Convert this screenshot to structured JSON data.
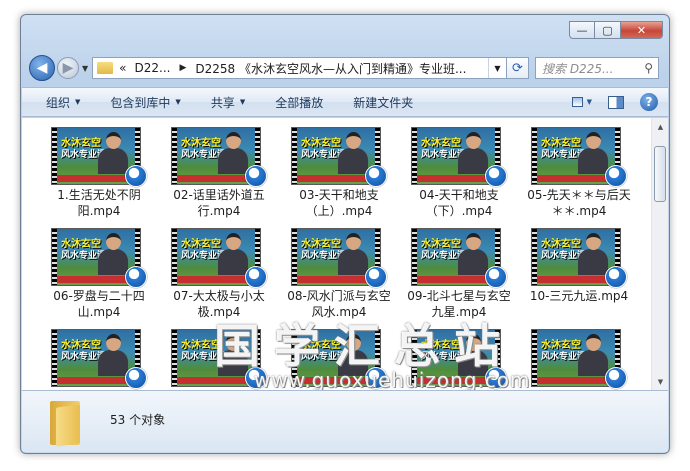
{
  "window": {
    "caption_buttons": [
      "—",
      "▢",
      "✕"
    ]
  },
  "nav": {
    "back_glyph": "◀",
    "forward_glyph": "▶",
    "address_prefix": "«",
    "crumb_1": "D22...",
    "crumb_2": "D2258 《水沐玄空风水—从入门到精通》专业班...",
    "search_placeholder": "搜索 D225..."
  },
  "toolbar": {
    "organize": "组织",
    "include_in_library": "包含到库中",
    "share": "共享",
    "play_all": "全部播放",
    "new_folder": "新建文件夹"
  },
  "thumb_text": {
    "line1": "水沐玄空",
    "line2": "风水专业课"
  },
  "files": [
    {
      "name": "1.生活无处不阴阳.mp4"
    },
    {
      "name": "02-话里话外道五行.mp4"
    },
    {
      "name": "03-天干和地支（上）.mp4"
    },
    {
      "name": "04-天干和地支（下）.mp4"
    },
    {
      "name": "05-先天＊＊与后天＊＊.mp4"
    },
    {
      "name": "06-罗盘与二十四山.mp4"
    },
    {
      "name": "07-大太极与小太极.mp4"
    },
    {
      "name": "08-风水门派与玄空风水.mp4"
    },
    {
      "name": "09-北斗七星与玄空九星.mp4"
    },
    {
      "name": "10-三元九运.mp4"
    },
    {
      "name": ""
    },
    {
      "name": ""
    },
    {
      "name": ""
    },
    {
      "name": ""
    },
    {
      "name": ""
    }
  ],
  "watermark": {
    "text": "国学汇总站",
    "url": "www.guoxuehuizong.com"
  },
  "status": {
    "count_text": "53 个对象"
  },
  "colors": {
    "accent": "#2b62ad",
    "thumb_title": "#fff22a",
    "badge": "#2a7bd6"
  }
}
